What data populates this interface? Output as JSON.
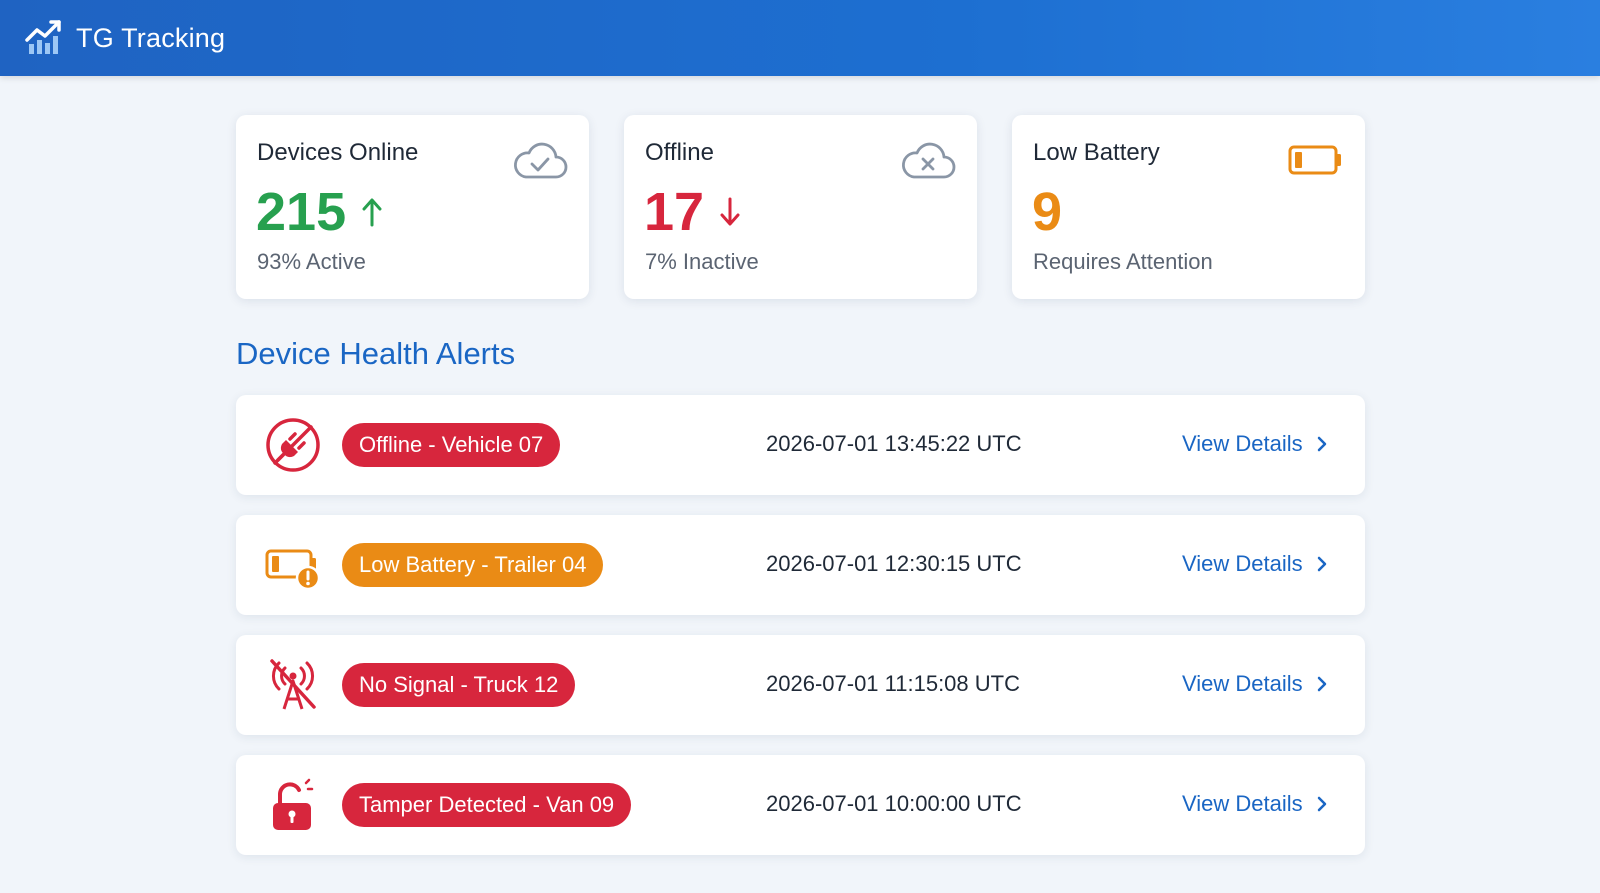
{
  "app": {
    "title": "TG Tracking",
    "logo_icon": "chart-trend-icon"
  },
  "colors": {
    "header": "#1f63c2",
    "accent_blue": "#1a66c4",
    "green": "#27a04f",
    "red": "#d7263d",
    "orange": "#ea8b15"
  },
  "cards": [
    {
      "title": "Devices Online",
      "value": "215",
      "trend": "up",
      "subtitle": "93% Active",
      "icon": "cloud-check-icon"
    },
    {
      "title": "Offline",
      "value": "17",
      "trend": "down",
      "subtitle": "7% Inactive",
      "icon": "cloud-x-icon"
    },
    {
      "title": "Low Battery",
      "value": "9",
      "trend": "",
      "subtitle": "Requires Attention",
      "icon": "battery-low-icon"
    }
  ],
  "alerts_section": {
    "title": "Device Health Alerts",
    "items": [
      {
        "label": "Offline - Vehicle 07",
        "timestamp": "2026-07-01 13:45:22 UTC",
        "link": "View Details",
        "icon": "unplugged-icon",
        "severity": "red"
      },
      {
        "label": "Low Battery - Trailer 04",
        "timestamp": "2026-07-01 12:30:15 UTC",
        "link": "View Details",
        "icon": "battery-warning-icon",
        "severity": "orange"
      },
      {
        "label": "No Signal - Truck 12",
        "timestamp": "2026-07-01 11:15:08 UTC",
        "link": "View Details",
        "icon": "no-signal-tower-icon",
        "severity": "red"
      },
      {
        "label": "Tamper Detected - Van 09",
        "timestamp": "2026-07-01 10:00:00 UTC",
        "link": "View Details",
        "icon": "unlocked-padlock-icon",
        "severity": "red"
      }
    ]
  }
}
